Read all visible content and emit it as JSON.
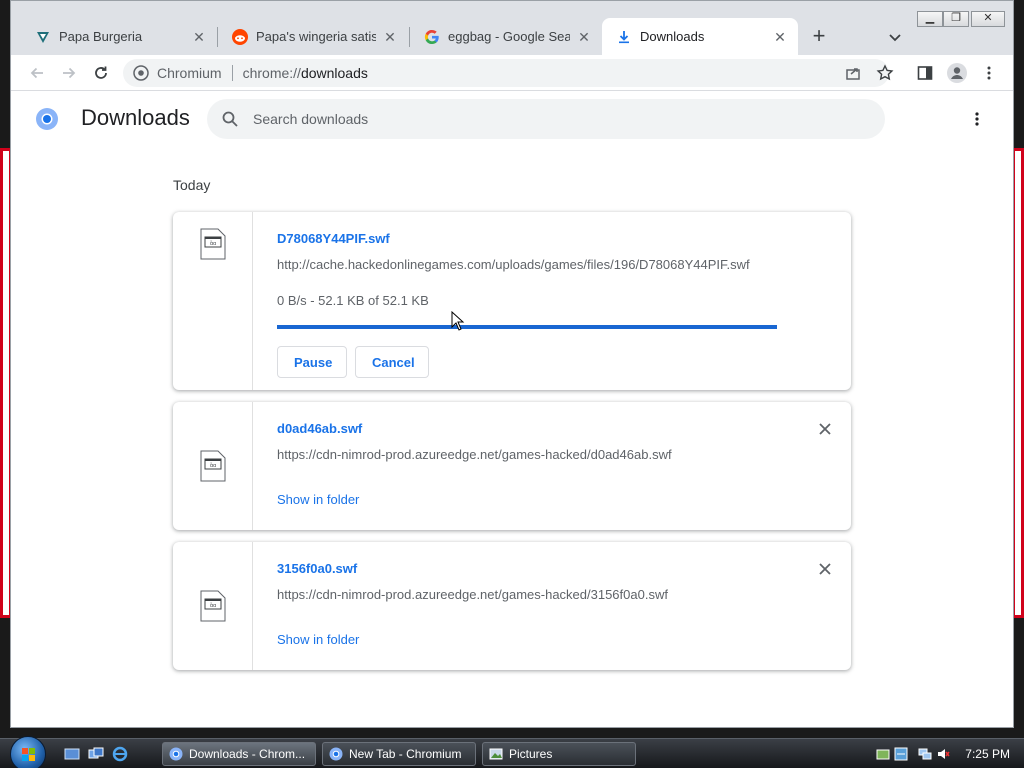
{
  "tabs": [
    {
      "title": "Papa Burgeria",
      "icon": "papa-burgeria-favicon"
    },
    {
      "title": "Papa's wingeria satisfact",
      "icon": "reddit-favicon"
    },
    {
      "title": "eggbag - Google Search",
      "icon": "google-favicon"
    },
    {
      "title": "Downloads",
      "icon": "download-icon",
      "active": true
    }
  ],
  "toolbar": {
    "site_label": "Chromium",
    "url_scheme": "chrome://",
    "url_path": "downloads"
  },
  "page": {
    "title": "Downloads",
    "search_placeholder": "Search downloads",
    "section": "Today"
  },
  "downloads": [
    {
      "name": "D78068Y44PIF.swf",
      "url": "http://cache.hackedonlinegames.com/uploads/games/files/196/D78068Y44PIF.swf",
      "status": "0 B/s - 52.1 KB of 52.1 KB",
      "progress_percent": 100,
      "pause_label": "Pause",
      "cancel_label": "Cancel"
    },
    {
      "name": "d0ad46ab.swf",
      "url": "https://cdn-nimrod-prod.azureedge.net/games-hacked/d0ad46ab.swf",
      "link": "Show in folder"
    },
    {
      "name": "3156f0a0.swf",
      "url": "https://cdn-nimrod-prod.azureedge.net/games-hacked/3156f0a0.swf",
      "link": "Show in folder"
    }
  ],
  "taskbar": {
    "tasks": [
      {
        "label": "Downloads - Chrom...",
        "active": true
      },
      {
        "label": "New Tab - Chromium"
      },
      {
        "label": "Pictures"
      }
    ],
    "clock": "7:25 PM"
  },
  "colors": {
    "accent": "#1a73e8",
    "progress": "#1967d2"
  }
}
